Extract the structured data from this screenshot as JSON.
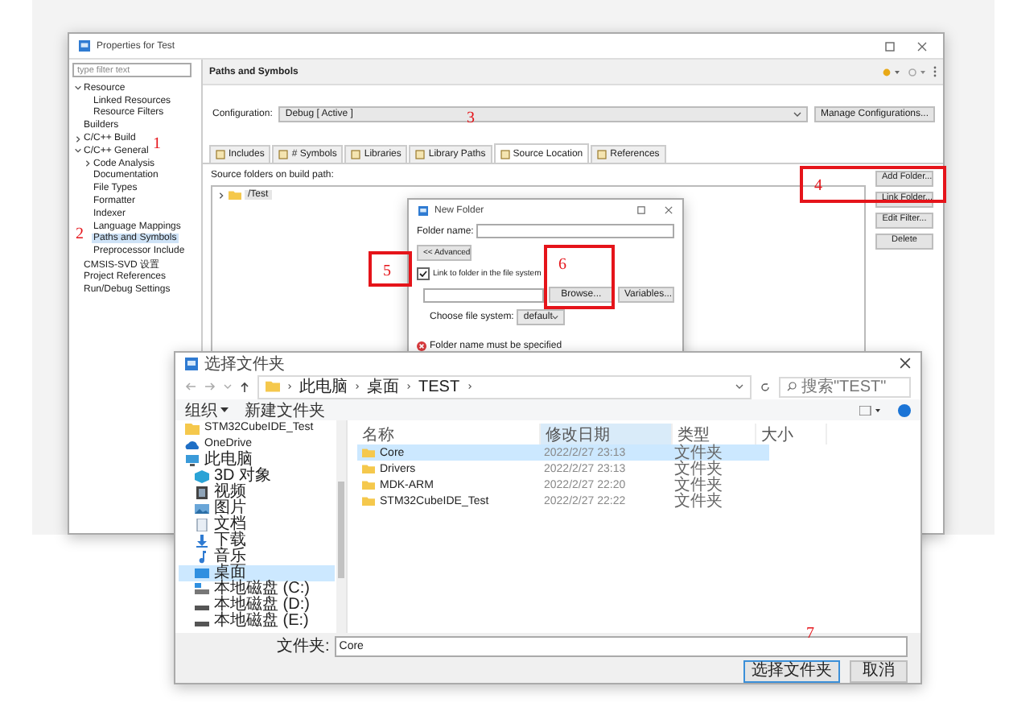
{
  "properties_window": {
    "title": "Properties for Test",
    "filter": {
      "placeholder": "type filter text"
    },
    "tree": [
      {
        "label": "Resource",
        "expanded": true,
        "selected": false,
        "children": [
          {
            "label": "Linked Resources",
            "selected": false
          },
          {
            "label": "Resource Filters",
            "selected": false
          }
        ]
      },
      {
        "label": "Builders",
        "selected": false
      },
      {
        "label": "C/C++ Build",
        "expanded": false,
        "selected": false
      },
      {
        "label": "C/C++ General",
        "expanded": true,
        "selected": false,
        "children": [
          {
            "label": "Code Analysis",
            "expanded": false,
            "selected": false
          },
          {
            "label": "Documentation",
            "selected": false
          },
          {
            "label": "File Types",
            "selected": false
          },
          {
            "label": "Formatter",
            "selected": false
          },
          {
            "label": "Indexer",
            "selected": false
          },
          {
            "label": "Language Mappings",
            "selected": false
          },
          {
            "label": "Paths and Symbols",
            "selected": true
          },
          {
            "label": "Preprocessor Include",
            "selected": false
          }
        ]
      },
      {
        "label": "CMSIS-SVD 设置",
        "selected": false
      },
      {
        "label": "Project References",
        "selected": false
      },
      {
        "label": "Run/Debug Settings",
        "selected": false
      }
    ],
    "page_title": "Paths and Symbols",
    "configuration": {
      "label": "Configuration:",
      "value": "Debug  [ Active ]"
    },
    "manage_button": "Manage Configurations...",
    "tabs": [
      {
        "label": "Includes",
        "selected": false
      },
      {
        "label": "# Symbols",
        "selected": false
      },
      {
        "label": "Libraries",
        "selected": false
      },
      {
        "label": "Library Paths",
        "selected": false
      },
      {
        "label": "Source Location",
        "selected": true
      },
      {
        "label": "References",
        "selected": false
      }
    ],
    "list_label": "Source folders on build path:",
    "folders": [
      {
        "label": "/Test",
        "expanded": false
      }
    ],
    "side_buttons": [
      "Add Folder...",
      "Link Folder...",
      "Edit Filter...",
      "Delete"
    ]
  },
  "new_folder": {
    "title": "New Folder",
    "name_label": "Folder name:",
    "advanced_button": "<< Advanced",
    "link": {
      "label": "Link to folder in the file system",
      "checked": true
    },
    "browse_button": "Browse...",
    "variables_button": "Variables...",
    "fs_label": "Choose file system:",
    "fs_value": "default",
    "error": "Folder name must be specified"
  },
  "file_dialog": {
    "title": "选择文件夹",
    "path": [
      "此电脑",
      "桌面",
      "TEST"
    ],
    "search": {
      "placeholder": "搜索\"TEST\""
    },
    "organize": "组织",
    "new_folder": "新建文件夹",
    "nav": [
      {
        "label": "STM32CubeIDE_Test",
        "kind": "folder",
        "selected": false
      },
      {
        "label": "OneDrive",
        "kind": "cloud",
        "selected": false
      },
      {
        "label": "此电脑",
        "kind": "computer",
        "selected": false,
        "children": [
          {
            "label": "3D 对象",
            "kind": "cube",
            "selected": false
          },
          {
            "label": "视频",
            "kind": "video",
            "selected": false
          },
          {
            "label": "图片",
            "kind": "image",
            "selected": false
          },
          {
            "label": "文档",
            "kind": "document",
            "selected": false
          },
          {
            "label": "下载",
            "kind": "download",
            "selected": false
          },
          {
            "label": "音乐",
            "kind": "music",
            "selected": false
          },
          {
            "label": "桌面",
            "kind": "desktop",
            "selected": true
          },
          {
            "label": "本地磁盘 (C:)",
            "kind": "system-drive",
            "selected": false
          },
          {
            "label": "本地磁盘 (D:)",
            "kind": "drive",
            "selected": false
          },
          {
            "label": "本地磁盘 (E:)",
            "kind": "drive",
            "selected": false
          }
        ]
      }
    ],
    "columns": [
      {
        "label": "名称",
        "sorted": false
      },
      {
        "label": "修改日期",
        "sorted": true
      },
      {
        "label": "类型",
        "sorted": false
      },
      {
        "label": "大小",
        "sorted": false
      }
    ],
    "rows": [
      {
        "name": "Core",
        "modified": "2022/2/27 23:13",
        "type": "文件夹",
        "selected": true
      },
      {
        "name": "Drivers",
        "modified": "2022/2/27 23:13",
        "type": "文件夹",
        "selected": false
      },
      {
        "name": "MDK-ARM",
        "modified": "2022/2/27 22:20",
        "type": "文件夹",
        "selected": false
      },
      {
        "name": "STM32CubeIDE_Test",
        "modified": "2022/2/27 22:22",
        "type": "文件夹",
        "selected": false
      }
    ],
    "filename_label": "文件夹:",
    "filename": "Core",
    "buttons": [
      "选择文件夹",
      "取消"
    ]
  },
  "annotations": [
    {
      "label": "1",
      "boxed": false
    },
    {
      "label": "2",
      "boxed": false
    },
    {
      "label": "3",
      "boxed": false
    },
    {
      "label": "4",
      "boxed": true
    },
    {
      "label": "5",
      "boxed": true
    },
    {
      "label": "6",
      "boxed": true
    },
    {
      "label": "7",
      "boxed": false
    }
  ]
}
